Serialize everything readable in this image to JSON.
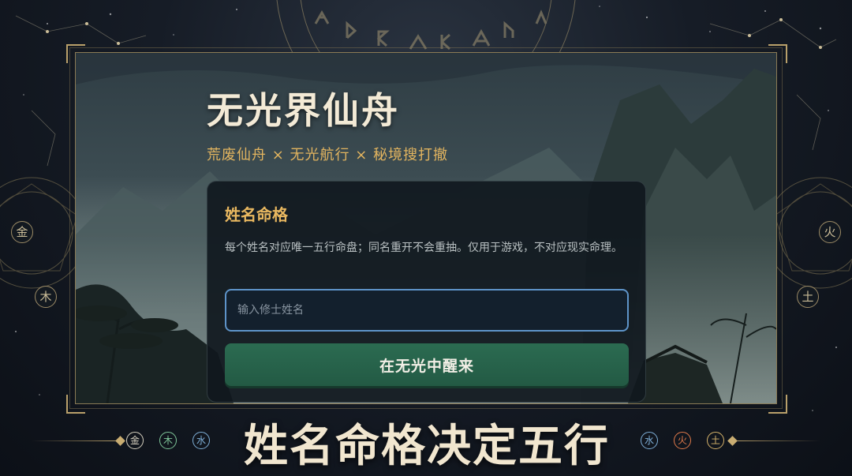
{
  "app": {
    "title": "无光界仙舟",
    "tagline": "荒废仙舟 × 无光航行 × 秘境搜打撤"
  },
  "name_card": {
    "title": "姓名命格",
    "description": "每个姓名对应唯一五行命盘；同名重开不会重抽。仅用于游戏，不对应现实命理。",
    "input_placeholder": "输入修士姓名",
    "input_value": "",
    "submit_label": "在无光中醒来"
  },
  "banner": {
    "headline": "姓名命格决定五行",
    "left_elements": [
      {
        "label": "金",
        "color": "#d8d2c0"
      },
      {
        "label": "木",
        "color": "#7fc79a"
      },
      {
        "label": "水",
        "color": "#7fb0d8"
      }
    ],
    "right_elements": [
      {
        "label": "水",
        "color": "#7fb0d8"
      },
      {
        "label": "火",
        "color": "#e07a4a"
      },
      {
        "label": "土",
        "color": "#d6b36a"
      }
    ]
  },
  "side_glyphs": {
    "left_top": "金",
    "left_bottom": "木",
    "right_top": "火",
    "right_bottom": "土"
  },
  "colors": {
    "accent_gold": "#e9b860",
    "button_green": "#2b6b51",
    "input_border": "#5e94c9"
  }
}
